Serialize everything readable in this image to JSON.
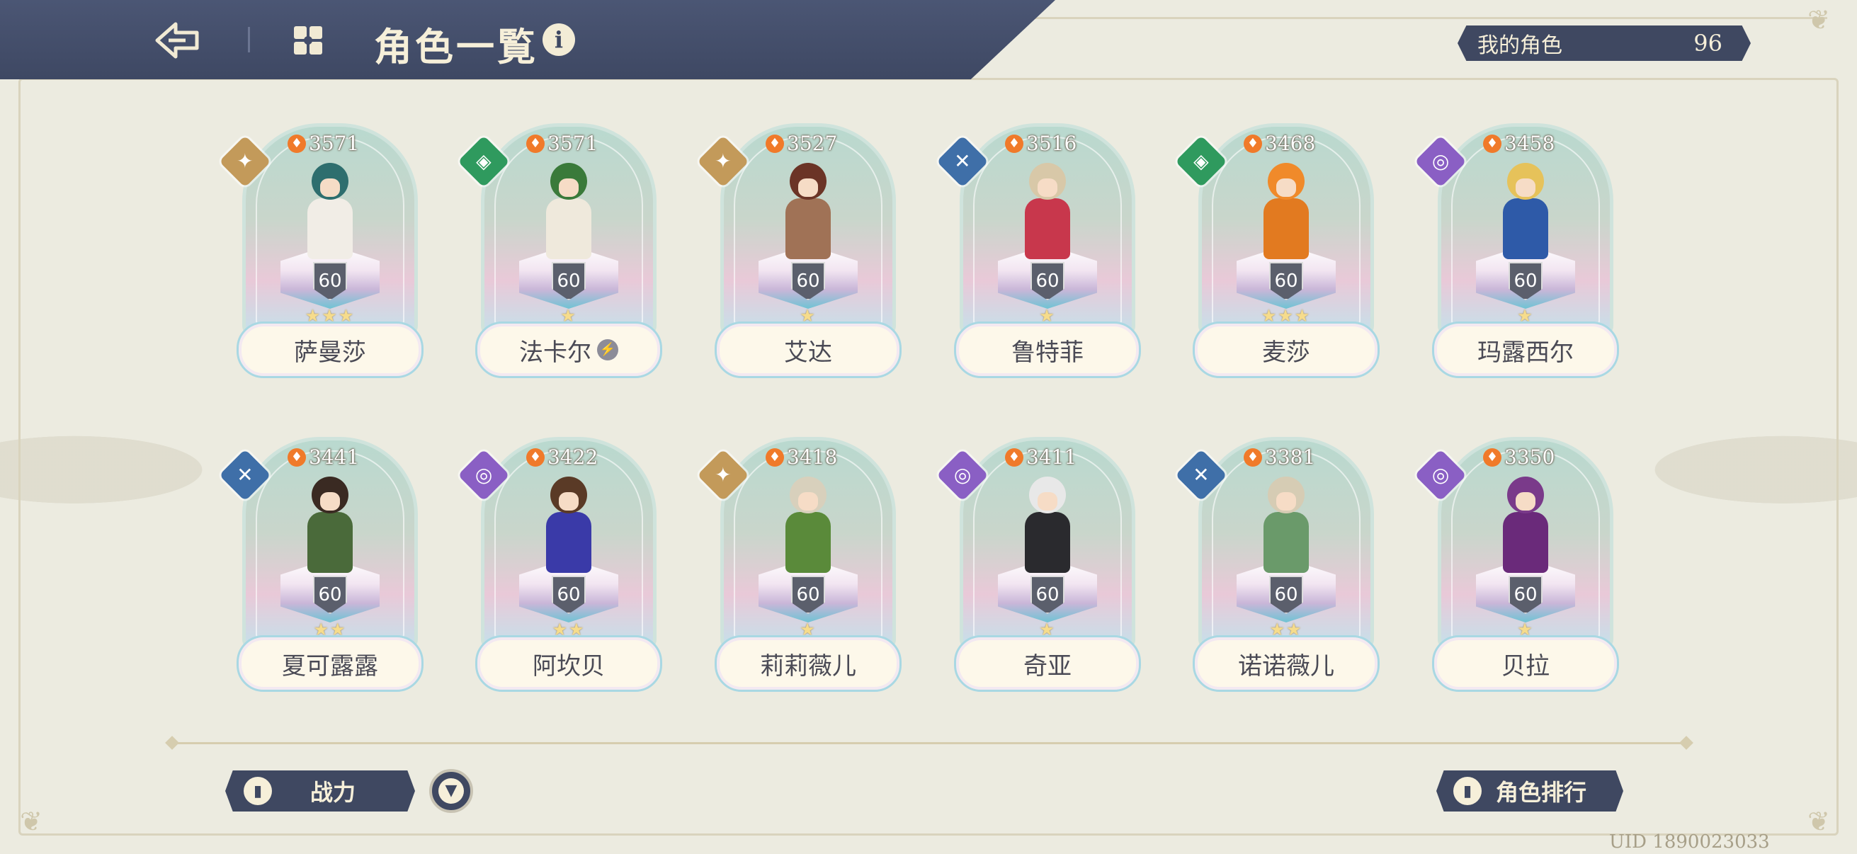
{
  "header": {
    "title": "角色一覧",
    "back_icon": "back-arrow-icon",
    "grid_icon": "grid-icon",
    "info_label": "i"
  },
  "my_roles": {
    "label": "我的角色",
    "count": "96"
  },
  "characters": [
    {
      "name": "萨曼莎",
      "power": "3571",
      "level": "60",
      "stars": "★★★",
      "element": "gold",
      "glyph": "✦",
      "hair": "#2e6e6e",
      "outfit": "#f1ede6",
      "badge": ""
    },
    {
      "name": "法卡尔",
      "power": "3571",
      "level": "60",
      "stars": "★",
      "element": "green",
      "glyph": "◈",
      "hair": "#3a7a3a",
      "outfit": "#efe9dc",
      "badge": "⚡"
    },
    {
      "name": "艾达",
      "power": "3527",
      "level": "60",
      "stars": "★",
      "element": "gold",
      "glyph": "✦",
      "hair": "#6b3426",
      "outfit": "#a07256",
      "badge": ""
    },
    {
      "name": "鲁特菲",
      "power": "3516",
      "level": "60",
      "stars": "★",
      "element": "blue",
      "glyph": "✕",
      "hair": "#d8c8a8",
      "outfit": "#c8374c",
      "badge": ""
    },
    {
      "name": "麦莎",
      "power": "3468",
      "level": "60",
      "stars": "★★★",
      "element": "green",
      "glyph": "◈",
      "hair": "#f08a2a",
      "outfit": "#e27a20",
      "badge": ""
    },
    {
      "name": "玛露西尔",
      "power": "3458",
      "level": "60",
      "stars": "★",
      "element": "purple",
      "glyph": "◎",
      "hair": "#e6c25a",
      "outfit": "#2e5aa8",
      "badge": ""
    },
    {
      "name": "夏可露露",
      "power": "3441",
      "level": "60",
      "stars": "★★",
      "element": "blue",
      "glyph": "✕",
      "hair": "#3a2a22",
      "outfit": "#4a6a3a",
      "badge": ""
    },
    {
      "name": "阿坎贝",
      "power": "3422",
      "level": "60",
      "stars": "★★",
      "element": "purple",
      "glyph": "◎",
      "hair": "#5a3a26",
      "outfit": "#3a3aa8",
      "badge": ""
    },
    {
      "name": "莉莉薇儿",
      "power": "3418",
      "level": "60",
      "stars": "★",
      "element": "gold",
      "glyph": "✦",
      "hair": "#d8d0bc",
      "outfit": "#5a8a3a",
      "badge": ""
    },
    {
      "name": "奇亚",
      "power": "3411",
      "level": "60",
      "stars": "★",
      "element": "purple",
      "glyph": "◎",
      "hair": "#e8e8e8",
      "outfit": "#2a2a2e",
      "badge": ""
    },
    {
      "name": "诺诺薇儿",
      "power": "3381",
      "level": "60",
      "stars": "★★",
      "element": "blue",
      "glyph": "✕",
      "hair": "#d6ccb4",
      "outfit": "#6a9a6a",
      "badge": ""
    },
    {
      "name": "贝拉",
      "power": "3350",
      "level": "60",
      "stars": "★",
      "element": "purple",
      "glyph": "◎",
      "hair": "#7a3a8a",
      "outfit": "#6a2a7a",
      "badge": ""
    }
  ],
  "footer": {
    "sort_label": "战力",
    "sort_icon": "bar-chart-icon",
    "filter_icon": "filter-icon",
    "ranking_label": "角色排行",
    "ranking_icon": "bar-chart-icon",
    "uid": "UID 1890023033"
  },
  "colors": {
    "header_bg": "#434d6a",
    "card_border": "#a9d8e3",
    "element_gold": "#c39a5a",
    "element_green": "#2f9a5e",
    "element_blue": "#3f6fa8",
    "element_purple": "#8a5fc4"
  }
}
